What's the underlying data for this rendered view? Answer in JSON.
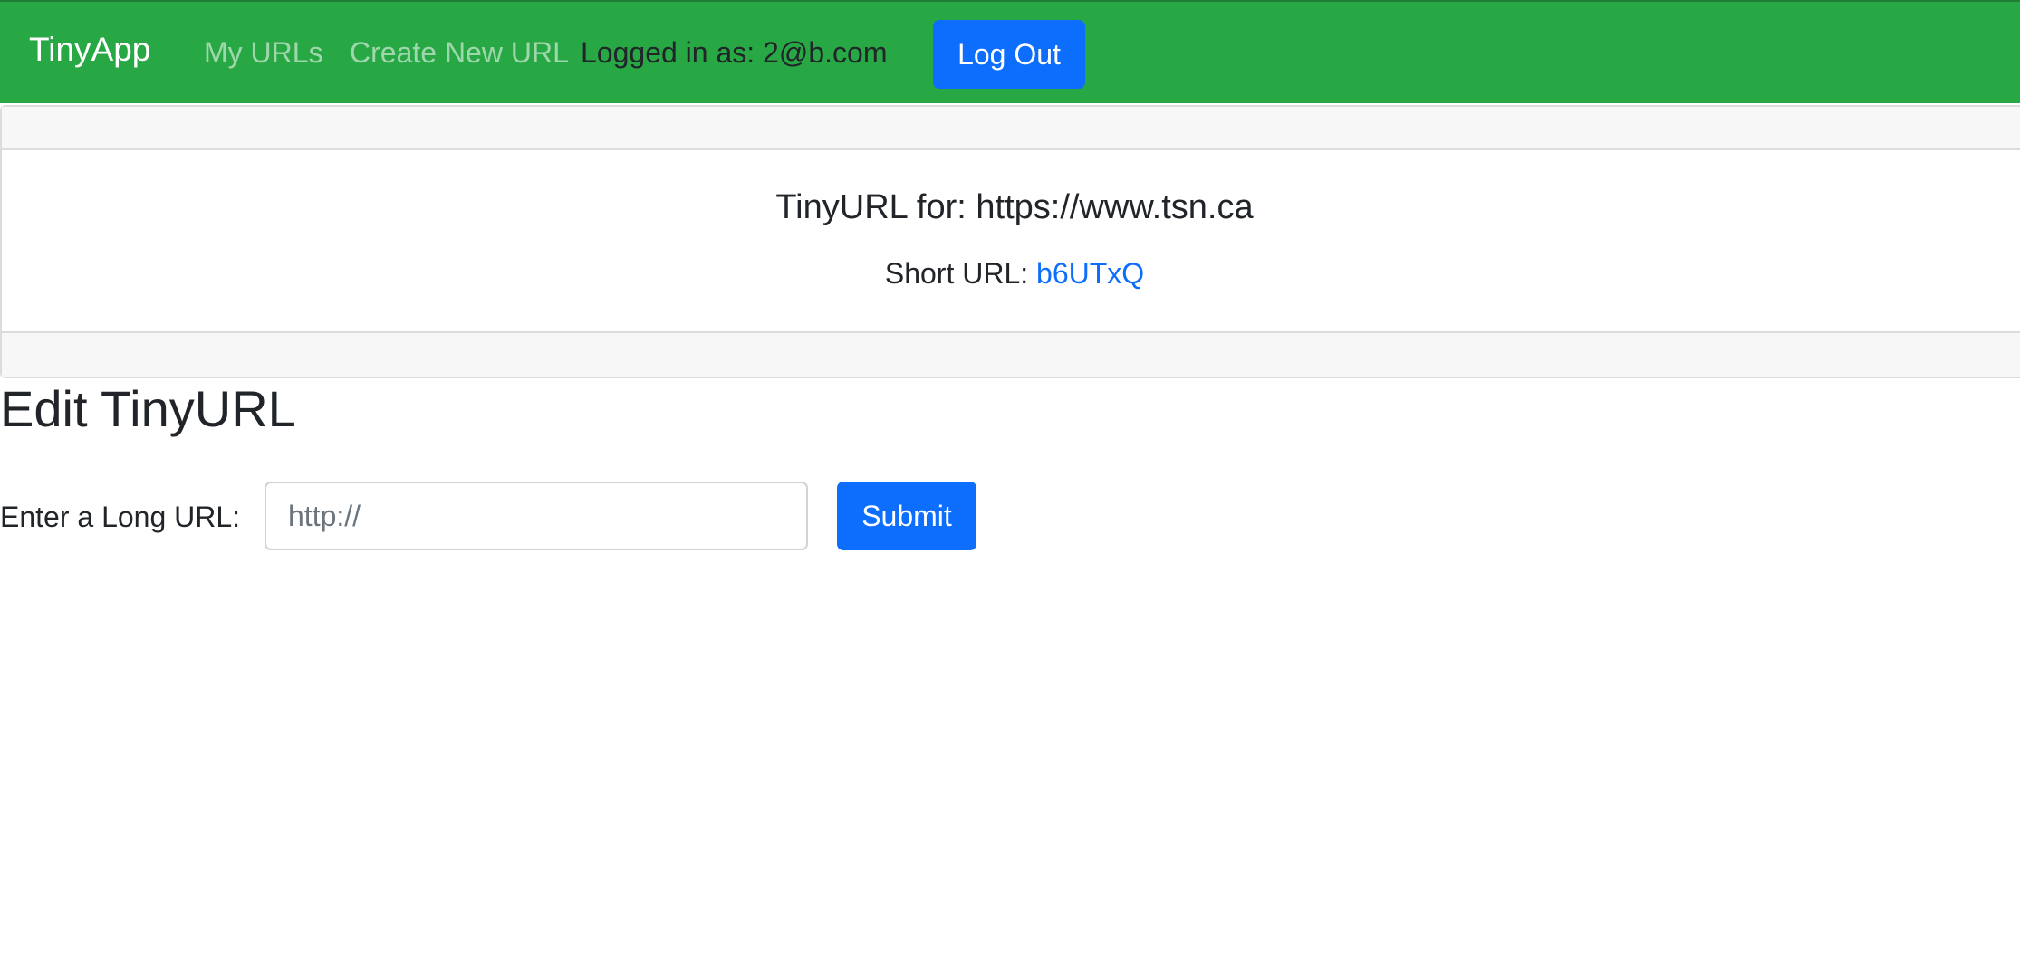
{
  "navbar": {
    "brand": "TinyApp",
    "links": [
      {
        "label": "My URLs"
      },
      {
        "label": "Create New URL"
      }
    ],
    "user_status": "Logged in as: 2@b.com",
    "logout_label": "Log Out",
    "background_color": "#28a745"
  },
  "card": {
    "title": "TinyURL for: https://www.tsn.ca",
    "short_url_label": "Short URL: ",
    "short_url_value": "b6UTxQ"
  },
  "edit_form": {
    "heading": "Edit TinyURL",
    "label": "Enter a Long URL:",
    "input_value": "",
    "input_placeholder": "http://",
    "submit_label": "Submit"
  },
  "colors": {
    "primary": "#0d6efd",
    "success": "#28a745"
  }
}
